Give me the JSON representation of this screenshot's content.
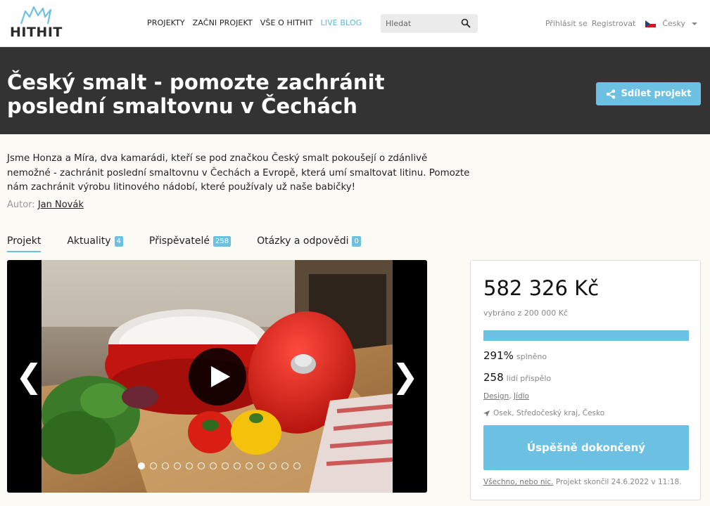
{
  "header": {
    "logo_text": "HITHIT",
    "nav": [
      "PROJEKTY",
      "ZAČNI PROJEKT",
      "VŠE O HITHIT",
      "LIVE BLOG"
    ],
    "search_placeholder": "Hledat",
    "login": "Přihlásit se",
    "register": "Registrovat",
    "language": "Česky",
    "icons": {
      "search": "search-icon",
      "flag": "czech-flag-icon",
      "language_menu": "caret-down-icon"
    }
  },
  "project": {
    "title": "Český smalt - pomozte zachránit poslední smaltovnu v Čechách",
    "share_label": "Sdílet projekt",
    "description": "Jsme Honza a Míra, dva kamarádi, kteří se pod značkou Český smalt pokoušejí o zdánlivě nemožné - zachránit poslední smaltovnu v Čechách a Evropě, která umí smaltovat litinu. Pomozte nám zachránit výrobu litinového nádobí, které používaly už naše babičky!",
    "author_label": "Autor:",
    "author_name": "Jan Novák"
  },
  "tabs": [
    {
      "label": "Projekt",
      "badge": null
    },
    {
      "label": "Aktuality",
      "badge": "4"
    },
    {
      "label": "Přispěvatelé",
      "badge": "258"
    },
    {
      "label": "Otázky a odpovědi",
      "badge": "0"
    }
  ],
  "gallery": {
    "prev": "❮",
    "next": "❯",
    "slide_count": 14,
    "active_slide": 1,
    "icons": {
      "play": "play-icon"
    }
  },
  "funding": {
    "amount": "582 326 Kč",
    "goal_text": "vybráno z 200 000 Kč",
    "progress_fraction": 1.0,
    "percent": "291%",
    "percent_label": "splněno",
    "backers": "258",
    "backers_label": "lidí přispělo",
    "categories": [
      "Design",
      "Jídlo"
    ],
    "location": "Osek, Středočeský kraj, Česko",
    "status_button": "Úspěšně dokončený",
    "model_link": "Všechno, nebo nic.",
    "ended_text": "Projekt skončil 24.6.2022 v 11:18."
  },
  "colors": {
    "accent": "#6cc1e3",
    "title_band": "#333333",
    "background": "#fbfaf5"
  }
}
